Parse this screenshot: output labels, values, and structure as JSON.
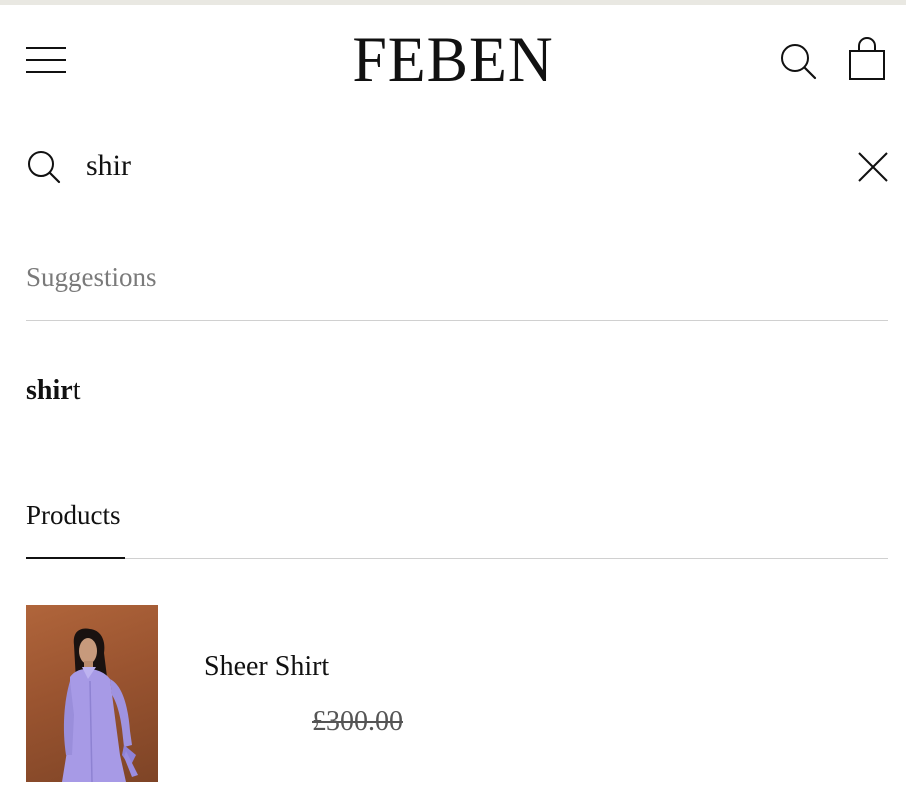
{
  "header": {
    "logo": "FEBEN",
    "menu_icon": "hamburger-menu-icon",
    "search_icon": "search-icon",
    "cart_icon": "shopping-bag-icon"
  },
  "search": {
    "value": "shir",
    "search_icon": "search-icon",
    "clear_icon": "close-icon"
  },
  "suggestions": {
    "label": "Suggestions",
    "items": [
      {
        "match": "shir",
        "rest": "t"
      }
    ]
  },
  "products": {
    "label": "Products",
    "items": [
      {
        "name": "Sheer Shirt",
        "price": "£300.00"
      }
    ]
  },
  "colors": {
    "text": "#111111",
    "muted": "#7a7a7a",
    "divider": "#d0d0d0",
    "top_strip": "#e9e8e2"
  }
}
